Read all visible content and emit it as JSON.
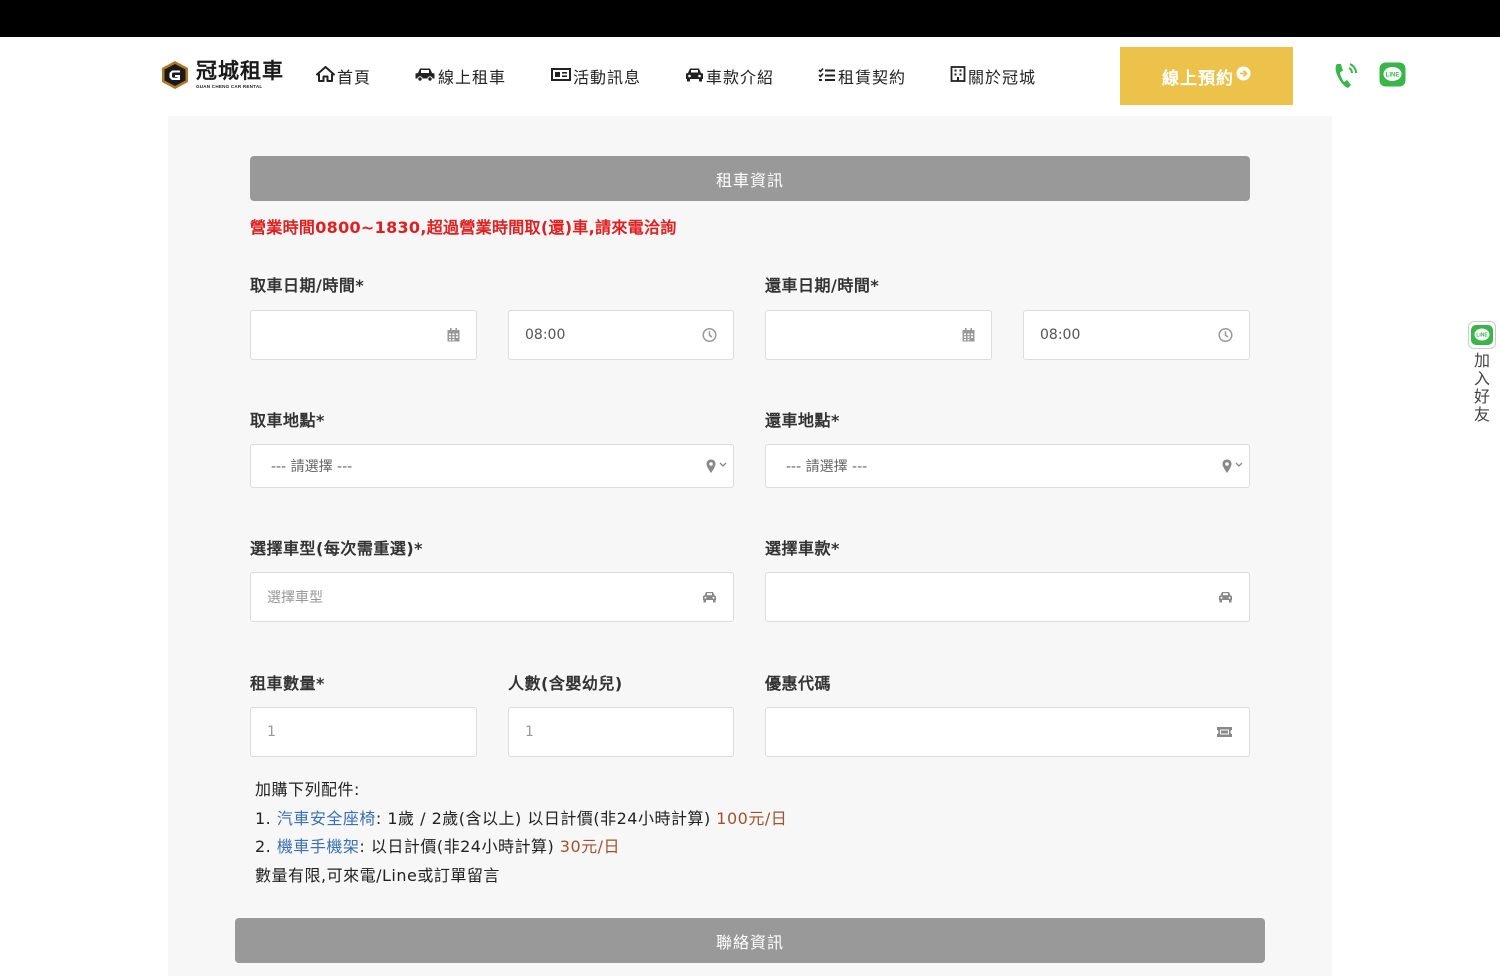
{
  "header": {
    "logo": {
      "title": "冠城租車",
      "subtitle": "GUAN CHENG CAR RENTAL",
      "icon": "g-logo-icon"
    },
    "nav": [
      {
        "label": "首頁",
        "icon": "home-icon"
      },
      {
        "label": "線上租車",
        "icon": "car-icon"
      },
      {
        "label": "活動訊息",
        "icon": "newspaper-icon"
      },
      {
        "label": "車款介紹",
        "icon": "car-front-icon"
      },
      {
        "label": "租賃契約",
        "icon": "list-icon"
      },
      {
        "label": "關於冠城",
        "icon": "building-icon"
      }
    ],
    "reserve_button": "線上預約",
    "phone_icon": "phone-ringing-icon",
    "line_icon": "line-app-icon"
  },
  "form": {
    "section_title": "租車資訊",
    "notice": "營業時間0800~1830,超過營業時間取(還)車,請來電洽詢",
    "pickup_datetime_label": "取車日期/時間*",
    "return_datetime_label": "還車日期/時間*",
    "pickup_date_value": "",
    "pickup_time_value": "08:00",
    "return_date_value": "",
    "return_time_value": "08:00",
    "pickup_location_label": "取車地點*",
    "return_location_label": "還車地點*",
    "pickup_location_value": "--- 請選擇 ---",
    "return_location_value": "--- 請選擇 ---",
    "car_type_label": "選擇車型(每次需重選)*",
    "car_type_placeholder": "選擇車型",
    "car_model_label": "選擇車款*",
    "car_model_value": "",
    "quantity_label": "租車數量*",
    "quantity_placeholder": "1",
    "people_label": "人數(含嬰幼兒)",
    "people_placeholder": "1",
    "coupon_label": "優惠代碼",
    "coupon_value": ""
  },
  "accessories": {
    "heading": "加購下列配件:",
    "item1_prefix": "1. ",
    "item1_link": "汽車安全座椅",
    "item1_text": ": 1歲 / 2歲(含以上) 以日計價(非24小時計算) ",
    "item1_price": "100元/日",
    "item2_prefix": "2. ",
    "item2_link": "機車手機架",
    "item2_text": ": 以日計價(非24小時計算) ",
    "item2_price": "30元/日",
    "note": "數量有限,可來電/Line或訂單留言"
  },
  "contact_section_title": "聯絡資訊",
  "side_widget": {
    "label": "加入好友",
    "icon": "line-app-icon"
  },
  "colors": {
    "accent_yellow": "#ecc24a",
    "section_gray": "#999999",
    "notice_red": "#e02020",
    "line_green": "#3ab54a",
    "link_blue": "#3b6fb6",
    "price_brown": "#a0522d"
  }
}
